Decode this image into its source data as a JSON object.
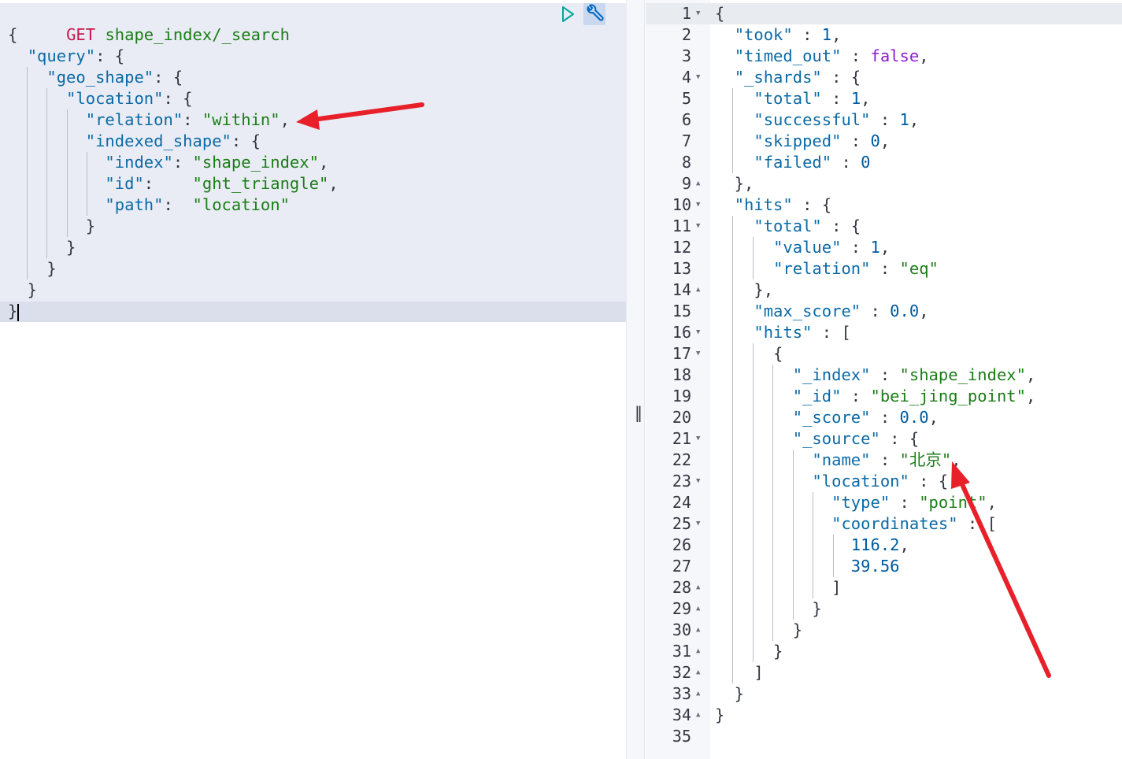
{
  "request": {
    "method": "GET",
    "path": "shape_index/_search",
    "lines": [
      [
        {
          "c": "p",
          "t": "{"
        }
      ],
      [
        {
          "c": "p",
          "t": "  "
        },
        {
          "c": "k",
          "t": "\"query\""
        },
        {
          "c": "p",
          "t": ": {"
        }
      ],
      [
        {
          "c": "p",
          "t": "    "
        },
        {
          "c": "k",
          "t": "\"geo_shape\""
        },
        {
          "c": "p",
          "t": ": {"
        }
      ],
      [
        {
          "c": "p",
          "t": "      "
        },
        {
          "c": "k",
          "t": "\"location\""
        },
        {
          "c": "p",
          "t": ": {"
        }
      ],
      [
        {
          "c": "p",
          "t": "        "
        },
        {
          "c": "k",
          "t": "\"relation\""
        },
        {
          "c": "p",
          "t": ": "
        },
        {
          "c": "s",
          "t": "\"within\""
        },
        {
          "c": "p",
          "t": ","
        }
      ],
      [
        {
          "c": "p",
          "t": "        "
        },
        {
          "c": "k",
          "t": "\"indexed_shape\""
        },
        {
          "c": "p",
          "t": ": {"
        }
      ],
      [
        {
          "c": "p",
          "t": "          "
        },
        {
          "c": "k",
          "t": "\"index\""
        },
        {
          "c": "p",
          "t": ": "
        },
        {
          "c": "s",
          "t": "\"shape_index\""
        },
        {
          "c": "p",
          "t": ","
        }
      ],
      [
        {
          "c": "p",
          "t": "          "
        },
        {
          "c": "k",
          "t": "\"id\""
        },
        {
          "c": "p",
          "t": ":    "
        },
        {
          "c": "s",
          "t": "\"ght_triangle\""
        },
        {
          "c": "p",
          "t": ","
        }
      ],
      [
        {
          "c": "p",
          "t": "          "
        },
        {
          "c": "k",
          "t": "\"path\""
        },
        {
          "c": "p",
          "t": ":  "
        },
        {
          "c": "s",
          "t": "\"location\""
        }
      ],
      [
        {
          "c": "p",
          "t": "        }"
        }
      ],
      [
        {
          "c": "p",
          "t": "      }"
        }
      ],
      [
        {
          "c": "p",
          "t": "    }"
        }
      ],
      [
        {
          "c": "p",
          "t": "  }"
        }
      ],
      [
        {
          "c": "p",
          "t": "}"
        }
      ]
    ]
  },
  "toolbar": {
    "run_icon": "play-icon",
    "settings_icon": "wrench-icon"
  },
  "resizer": {
    "label": "‖"
  },
  "response": {
    "line_numbers": [
      "1",
      "2",
      "3",
      "4",
      "5",
      "6",
      "7",
      "8",
      "9",
      "10",
      "11",
      "12",
      "13",
      "14",
      "15",
      "16",
      "17",
      "18",
      "19",
      "20",
      "21",
      "22",
      "23",
      "24",
      "25",
      "26",
      "27",
      "28",
      "29",
      "30",
      "31",
      "32",
      "33",
      "34",
      "35"
    ],
    "folds": {
      "1": "down",
      "4": "down",
      "9": "up",
      "10": "down",
      "11": "down",
      "14": "up",
      "16": "down",
      "17": "down",
      "21": "down",
      "23": "down",
      "25": "down",
      "28": "up",
      "29": "up",
      "30": "up",
      "31": "up",
      "32": "up",
      "33": "up",
      "34": "up"
    },
    "lines": [
      [
        {
          "c": "p",
          "t": "{"
        }
      ],
      [
        {
          "c": "p",
          "t": "  "
        },
        {
          "c": "k",
          "t": "\"took\""
        },
        {
          "c": "p",
          "t": " : "
        },
        {
          "c": "n",
          "t": "1"
        },
        {
          "c": "p",
          "t": ","
        }
      ],
      [
        {
          "c": "p",
          "t": "  "
        },
        {
          "c": "k",
          "t": "\"timed_out\""
        },
        {
          "c": "p",
          "t": " : "
        },
        {
          "c": "b",
          "t": "false"
        },
        {
          "c": "p",
          "t": ","
        }
      ],
      [
        {
          "c": "p",
          "t": "  "
        },
        {
          "c": "k",
          "t": "\"_shards\""
        },
        {
          "c": "p",
          "t": " : {"
        }
      ],
      [
        {
          "c": "p",
          "t": "    "
        },
        {
          "c": "k",
          "t": "\"total\""
        },
        {
          "c": "p",
          "t": " : "
        },
        {
          "c": "n",
          "t": "1"
        },
        {
          "c": "p",
          "t": ","
        }
      ],
      [
        {
          "c": "p",
          "t": "    "
        },
        {
          "c": "k",
          "t": "\"successful\""
        },
        {
          "c": "p",
          "t": " : "
        },
        {
          "c": "n",
          "t": "1"
        },
        {
          "c": "p",
          "t": ","
        }
      ],
      [
        {
          "c": "p",
          "t": "    "
        },
        {
          "c": "k",
          "t": "\"skipped\""
        },
        {
          "c": "p",
          "t": " : "
        },
        {
          "c": "n",
          "t": "0"
        },
        {
          "c": "p",
          "t": ","
        }
      ],
      [
        {
          "c": "p",
          "t": "    "
        },
        {
          "c": "k",
          "t": "\"failed\""
        },
        {
          "c": "p",
          "t": " : "
        },
        {
          "c": "n",
          "t": "0"
        }
      ],
      [
        {
          "c": "p",
          "t": "  },"
        }
      ],
      [
        {
          "c": "p",
          "t": "  "
        },
        {
          "c": "k",
          "t": "\"hits\""
        },
        {
          "c": "p",
          "t": " : {"
        }
      ],
      [
        {
          "c": "p",
          "t": "    "
        },
        {
          "c": "k",
          "t": "\"total\""
        },
        {
          "c": "p",
          "t": " : {"
        }
      ],
      [
        {
          "c": "p",
          "t": "      "
        },
        {
          "c": "k",
          "t": "\"value\""
        },
        {
          "c": "p",
          "t": " : "
        },
        {
          "c": "n",
          "t": "1"
        },
        {
          "c": "p",
          "t": ","
        }
      ],
      [
        {
          "c": "p",
          "t": "      "
        },
        {
          "c": "k",
          "t": "\"relation\""
        },
        {
          "c": "p",
          "t": " : "
        },
        {
          "c": "s",
          "t": "\"eq\""
        }
      ],
      [
        {
          "c": "p",
          "t": "    },"
        }
      ],
      [
        {
          "c": "p",
          "t": "    "
        },
        {
          "c": "k",
          "t": "\"max_score\""
        },
        {
          "c": "p",
          "t": " : "
        },
        {
          "c": "n",
          "t": "0.0"
        },
        {
          "c": "p",
          "t": ","
        }
      ],
      [
        {
          "c": "p",
          "t": "    "
        },
        {
          "c": "k",
          "t": "\"hits\""
        },
        {
          "c": "p",
          "t": " : ["
        }
      ],
      [
        {
          "c": "p",
          "t": "      {"
        }
      ],
      [
        {
          "c": "p",
          "t": "        "
        },
        {
          "c": "k",
          "t": "\"_index\""
        },
        {
          "c": "p",
          "t": " : "
        },
        {
          "c": "s",
          "t": "\"shape_index\""
        },
        {
          "c": "p",
          "t": ","
        }
      ],
      [
        {
          "c": "p",
          "t": "        "
        },
        {
          "c": "k",
          "t": "\"_id\""
        },
        {
          "c": "p",
          "t": " : "
        },
        {
          "c": "s",
          "t": "\"bei_jing_point\""
        },
        {
          "c": "p",
          "t": ","
        }
      ],
      [
        {
          "c": "p",
          "t": "        "
        },
        {
          "c": "k",
          "t": "\"_score\""
        },
        {
          "c": "p",
          "t": " : "
        },
        {
          "c": "n",
          "t": "0.0"
        },
        {
          "c": "p",
          "t": ","
        }
      ],
      [
        {
          "c": "p",
          "t": "        "
        },
        {
          "c": "k",
          "t": "\"_source\""
        },
        {
          "c": "p",
          "t": " : {"
        }
      ],
      [
        {
          "c": "p",
          "t": "          "
        },
        {
          "c": "k",
          "t": "\"name\""
        },
        {
          "c": "p",
          "t": " : "
        },
        {
          "c": "s",
          "t": "\"北京\""
        },
        {
          "c": "p",
          "t": ","
        }
      ],
      [
        {
          "c": "p",
          "t": "          "
        },
        {
          "c": "k",
          "t": "\"location\""
        },
        {
          "c": "p",
          "t": " : {"
        }
      ],
      [
        {
          "c": "p",
          "t": "            "
        },
        {
          "c": "k",
          "t": "\"type\""
        },
        {
          "c": "p",
          "t": " : "
        },
        {
          "c": "s",
          "t": "\"point\""
        },
        {
          "c": "p",
          "t": ","
        }
      ],
      [
        {
          "c": "p",
          "t": "            "
        },
        {
          "c": "k",
          "t": "\"coordinates\""
        },
        {
          "c": "p",
          "t": " : ["
        }
      ],
      [
        {
          "c": "p",
          "t": "              "
        },
        {
          "c": "n",
          "t": "116.2"
        },
        {
          "c": "p",
          "t": ","
        }
      ],
      [
        {
          "c": "p",
          "t": "              "
        },
        {
          "c": "n",
          "t": "39.56"
        }
      ],
      [
        {
          "c": "p",
          "t": "            ]"
        }
      ],
      [
        {
          "c": "p",
          "t": "          }"
        }
      ],
      [
        {
          "c": "p",
          "t": "        }"
        }
      ],
      [
        {
          "c": "p",
          "t": "      }"
        }
      ],
      [
        {
          "c": "p",
          "t": "    ]"
        }
      ],
      [
        {
          "c": "p",
          "t": "  }"
        }
      ],
      [
        {
          "c": "p",
          "t": "}"
        }
      ],
      [
        {
          "c": "p",
          "t": ""
        }
      ]
    ]
  },
  "colors": {
    "method": "#c5194e",
    "key": "#0b6aa6",
    "string": "#1b7d17",
    "number": "#005a9e",
    "boolean": "#8c1bd0",
    "arrow": "#e8202a",
    "run_icon": "#00a69b",
    "wrench_icon": "#0067c4"
  }
}
